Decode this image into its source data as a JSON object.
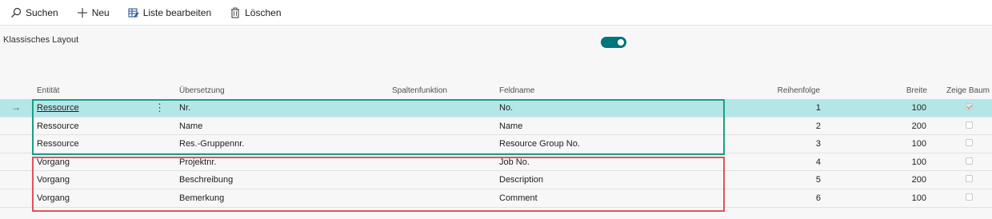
{
  "toolbar": {
    "search_label": "Suchen",
    "new_label": "Neu",
    "edit_list_label": "Liste bearbeiten",
    "delete_label": "Löschen"
  },
  "settings": {
    "layout_label": "Klassisches Layout",
    "layout_toggle_on": true,
    "accent_color": "#00757a"
  },
  "grid": {
    "columns": {
      "entity": "Entität",
      "translation": "Übersetzung",
      "column_function": "Spaltenfunktion",
      "field_name": "Feldname",
      "order": "Reihenfolge",
      "width": "Breite",
      "show_tree": "Zeige Baum"
    },
    "rows": [
      {
        "entity": "Ressource",
        "translation": "Nr.",
        "column_function": "",
        "field_name": "No.",
        "order": "1",
        "width": "100",
        "show_tree": true
      },
      {
        "entity": "Ressource",
        "translation": "Name",
        "column_function": "",
        "field_name": "Name",
        "order": "2",
        "width": "200",
        "show_tree": false
      },
      {
        "entity": "Ressource",
        "translation": "Res.-Gruppennr.",
        "column_function": "",
        "field_name": "Resource Group No.",
        "order": "3",
        "width": "100",
        "show_tree": false
      },
      {
        "entity": "Vorgang",
        "translation": "Projektnr.",
        "column_function": "",
        "field_name": "Job No.",
        "order": "4",
        "width": "100",
        "show_tree": false
      },
      {
        "entity": "Vorgang",
        "translation": "Beschreibung",
        "column_function": "",
        "field_name": "Description",
        "order": "5",
        "width": "200",
        "show_tree": false
      },
      {
        "entity": "Vorgang",
        "translation": "Bemerkung",
        "column_function": "",
        "field_name": "Comment",
        "order": "6",
        "width": "100",
        "show_tree": false
      }
    ],
    "selected_row_marker": "→",
    "row_actions_glyph": "⋮",
    "selected_row_color": "#b4e6e8"
  },
  "highlights": {
    "ressource_box_color": "#18a085",
    "vorgang_box_color": "#e0525a"
  }
}
